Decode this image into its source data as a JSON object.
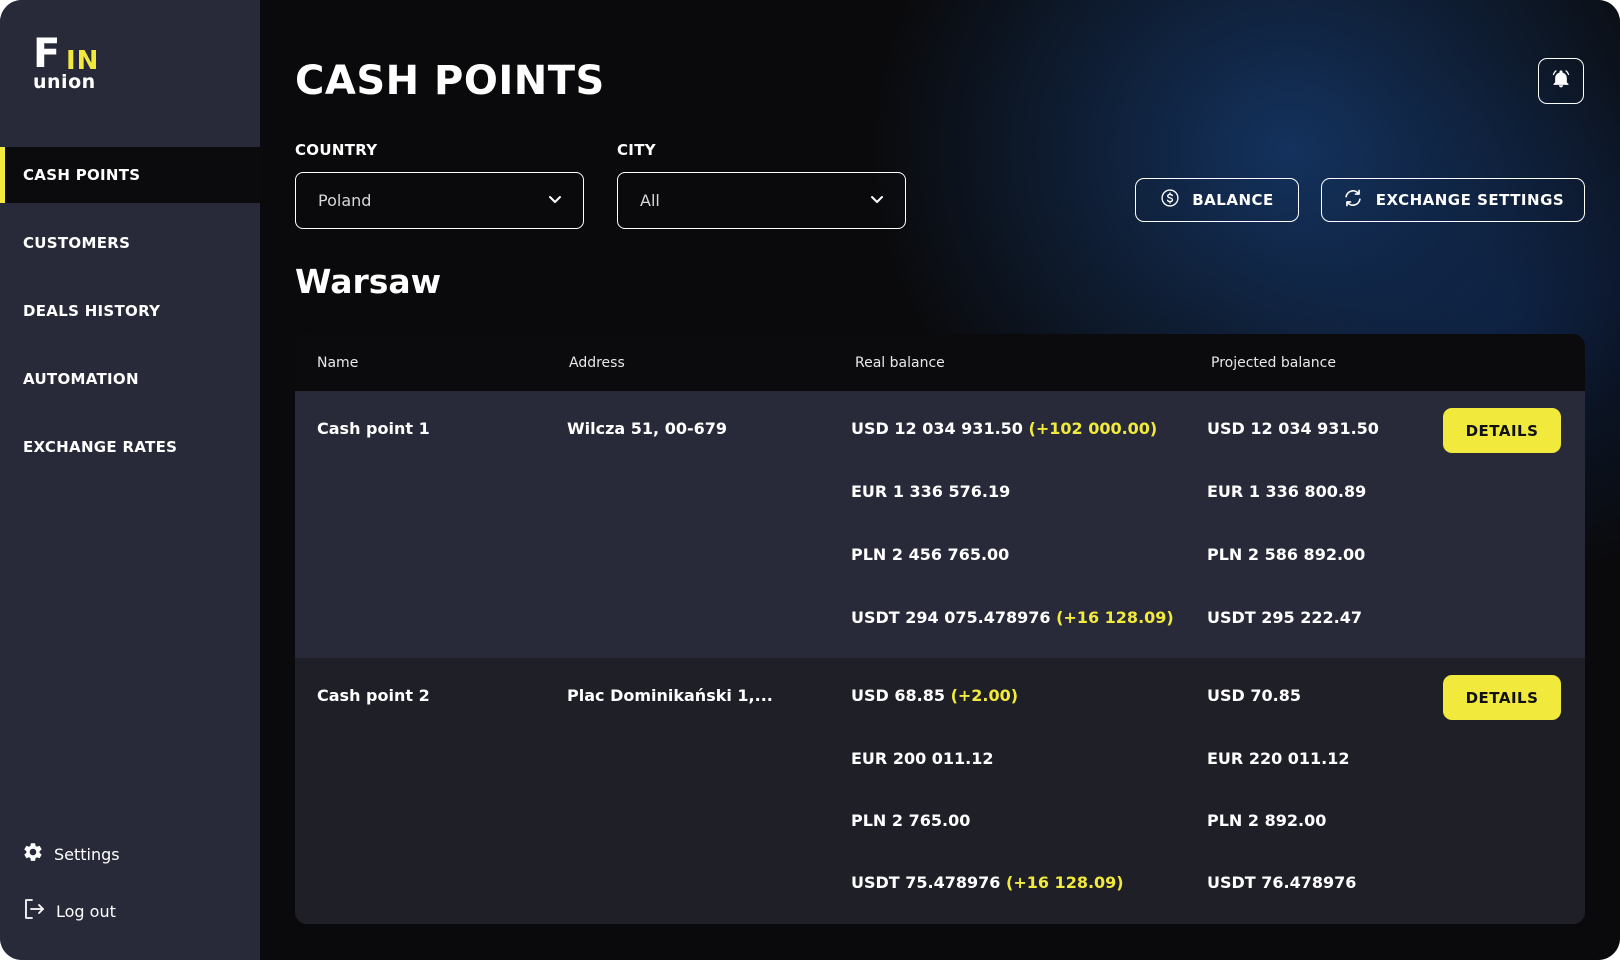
{
  "brand": {
    "logo_f": "F",
    "logo_in": "IN",
    "logo_union": "union",
    "accent": "#f1ea3c"
  },
  "sidebar": {
    "items": [
      {
        "label": "CASH POINTS",
        "active": true
      },
      {
        "label": "CUSTOMERS",
        "active": false
      },
      {
        "label": "DEALS HISTORY",
        "active": false
      },
      {
        "label": "AUTOMATION",
        "active": false
      },
      {
        "label": "EXCHANGE RATES",
        "active": false
      }
    ],
    "settings": {
      "label": "Settings",
      "icon": "gear-icon"
    },
    "logout": {
      "label": "Log out",
      "icon": "logout-icon"
    }
  },
  "header": {
    "title": "CASH POINTS",
    "notification_icon": "bell-icon"
  },
  "filters": {
    "country": {
      "label": "COUNTRY",
      "value": "Poland"
    },
    "city": {
      "label": "CITY",
      "value": "All"
    }
  },
  "actions": {
    "balance": {
      "label": "BALANCE",
      "icon": "dollar-circle-icon"
    },
    "exchange_settings": {
      "label": "EXCHANGE SETTINGS",
      "icon": "refresh-icon"
    }
  },
  "section": {
    "city": "Warsaw"
  },
  "table": {
    "columns": {
      "name": "Name",
      "address": "Address",
      "real": "Real balance",
      "projected": "Projected balance"
    },
    "details_label": "DETAILS",
    "rows": [
      {
        "name": "Cash point 1",
        "address": "Wilcza 51, 00-679",
        "real": [
          {
            "value": "USD 12 034 931.50",
            "delta": "(+102 000.00)"
          },
          {
            "value": "EUR 1 336 576.19",
            "delta": ""
          },
          {
            "value": "PLN 2 456 765.00",
            "delta": ""
          },
          {
            "value": "USDT 294 075.478976",
            "delta": "(+16 128.09)"
          }
        ],
        "projected": [
          "USD 12 034 931.50",
          "EUR 1 336 800.89",
          "PLN 2 586 892.00",
          "USDT 295 222.47"
        ]
      },
      {
        "name": "Cash point 2",
        "address": "Plac Dominikański 1,...",
        "real": [
          {
            "value": "USD 68.85",
            "delta": "(+2.00)"
          },
          {
            "value": "EUR 200 011.12",
            "delta": ""
          },
          {
            "value": "PLN 2 765.00",
            "delta": ""
          },
          {
            "value": "USDT 75.478976",
            "delta": "(+16 128.09)"
          }
        ],
        "projected": [
          "USD 70.85",
          "EUR 220 011.12",
          "PLN 2 892.00",
          "USDT 76.478976"
        ]
      }
    ]
  }
}
